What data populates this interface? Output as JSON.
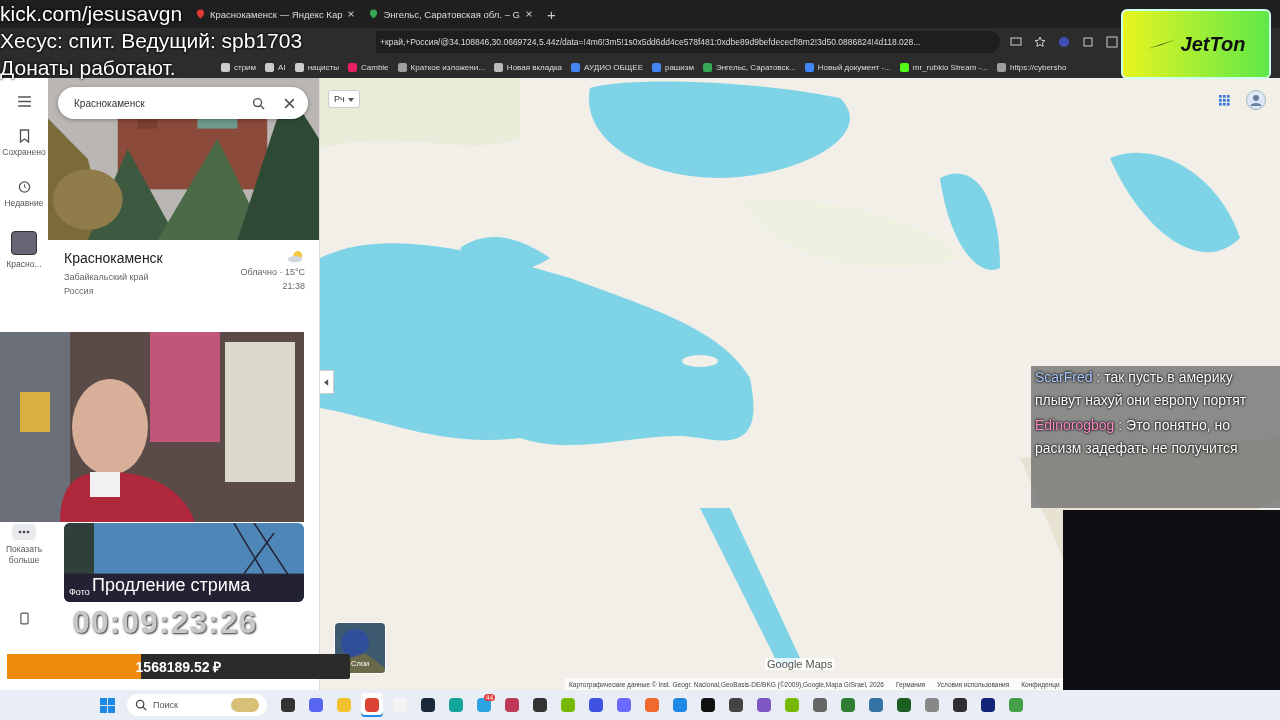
{
  "browser": {
    "tabs": [
      {
        "title": "Краснокаменск — Яндекс Кар",
        "selected": false
      },
      {
        "title": "Энгельс, Саратовская обл. – G",
        "selected": false
      }
    ],
    "new_tab": "+",
    "address": "+край,+Россия/@34.108846,30.0669724,5.44z/data=!4m6!3m5!1s0x5dd6dd4ce578f481:0xdbe89d9befdececf!8m2!3d50.0886824!4d118.028...",
    "bookmarks": [
      {
        "label": "стрим",
        "kind": "folder"
      },
      {
        "label": "AI",
        "kind": "folder"
      },
      {
        "label": "нацисты",
        "kind": "folder"
      },
      {
        "label": "Camble",
        "kind": "app"
      },
      {
        "label": "Краткое изложени...",
        "kind": "globe"
      },
      {
        "label": "Новая вкладка",
        "kind": "page"
      },
      {
        "label": "АУДИО ОБЩЕЕ",
        "kind": "doc"
      },
      {
        "label": "рашизм",
        "kind": "doc"
      },
      {
        "label": "Энгельс, Саратовск...",
        "kind": "pin"
      },
      {
        "label": "Новый документ -...",
        "kind": "doc"
      },
      {
        "label": "mr_rubkio Stream -...",
        "kind": "kick"
      },
      {
        "label": "https://cybersho",
        "kind": "globe"
      }
    ]
  },
  "maps": {
    "rail": [
      {
        "label": "Сохранено",
        "kind": "saved"
      },
      {
        "label": "Недавние",
        "kind": "recent"
      },
      {
        "label": "Красно...",
        "kind": "place"
      },
      {
        "label": "Показать больше",
        "kind": "more"
      }
    ],
    "search": {
      "value": "Краснокаменск"
    },
    "place": {
      "title": "Краснокаменск",
      "region": "Забайкальский край",
      "country": "Россия",
      "weather": "Облачно · 15°C",
      "time": "21:38"
    },
    "map": {
      "language_button": "Рч",
      "layers_label": "Слои",
      "logo": "Google Maps",
      "attribution": [
        "Картографические данные © Inst. Geogr. Nacional,GeoBasis-DE/BKG (©2009),Google,Mapa GISrael, 2026",
        "Германия",
        "Условия использования",
        "Конфиденци"
      ]
    }
  },
  "stream_overlay": {
    "lines": [
      "kick.com/jesusavgn",
      "Хесус: спит. Ведущий: spb1703",
      "Донаты работают."
    ],
    "logo": "JetTon",
    "chat": [
      {
        "user": "ScarFred",
        "color": "#a8c8ff",
        "text": ": так пусть в америку плывут нахуй они европу портят"
      },
      {
        "user": "Edinorogbog",
        "color": "#ff8cc6",
        "text": ": Это понятно, но расизм задефать не получится"
      }
    ],
    "banner": {
      "label": "Фото",
      "title": "Продление стрима"
    },
    "timer": "00:09:23:26",
    "donation": {
      "amount": "1568189.52 ₽",
      "level": 0.39
    }
  },
  "taskbar": {
    "search_placeholder": "Поиск",
    "apps": [
      {
        "kind": "terminal",
        "selected": false
      },
      {
        "kind": "discord",
        "selected": false
      },
      {
        "kind": "files",
        "selected": false
      },
      {
        "kind": "chrome",
        "selected": true
      },
      {
        "kind": "doc",
        "selected": false
      },
      {
        "kind": "steam",
        "selected": false
      },
      {
        "kind": "wave",
        "selected": false
      },
      {
        "kind": "telegram",
        "badge": "44",
        "selected": false
      },
      {
        "kind": "snip",
        "selected": false
      },
      {
        "kind": "terminal",
        "selected": false
      },
      {
        "kind": "nvidia",
        "selected": false
      },
      {
        "kind": "vpn",
        "selected": false
      },
      {
        "kind": "arrow",
        "selected": false
      },
      {
        "kind": "spark",
        "selected": false
      },
      {
        "kind": "check",
        "selected": false
      },
      {
        "kind": "capcut",
        "selected": false
      },
      {
        "kind": "ai",
        "selected": false
      },
      {
        "kind": "layers",
        "selected": false
      },
      {
        "kind": "nvidia",
        "selected": false
      },
      {
        "kind": "camera",
        "selected": false
      },
      {
        "kind": "plane",
        "selected": false
      },
      {
        "kind": "python",
        "selected": false
      },
      {
        "kind": "globe",
        "selected": false
      },
      {
        "kind": "fan",
        "selected": false
      },
      {
        "kind": "obs",
        "selected": false
      },
      {
        "kind": "x",
        "selected": false
      },
      {
        "kind": "battery",
        "selected": false
      }
    ]
  }
}
